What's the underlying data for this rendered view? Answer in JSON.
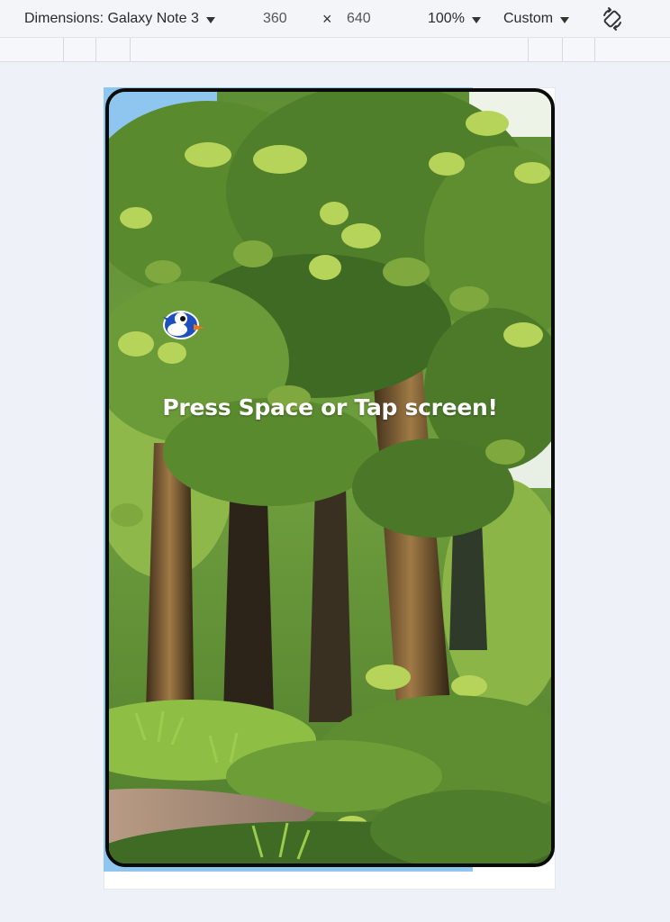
{
  "toolbar": {
    "dimensions_label": "Dimensions: Galaxy Note 3",
    "width": "360",
    "times": "×",
    "height": "640",
    "zoom": "100%",
    "throttle": "Custom"
  },
  "game": {
    "prompt": "Press Space or Tap screen!"
  },
  "icons": {
    "rotate": "rotate-icon",
    "caret": "chevron-down-icon",
    "bird": "bird-icon"
  },
  "colors": {
    "toolbar_bg": "#f3f5f9",
    "page_bg": "#eef1f7",
    "sky": "#8ec6ef",
    "frame": "#0b0b0b",
    "foliage_dark": "#3e6a23",
    "foliage_light": "#b7d45a"
  }
}
